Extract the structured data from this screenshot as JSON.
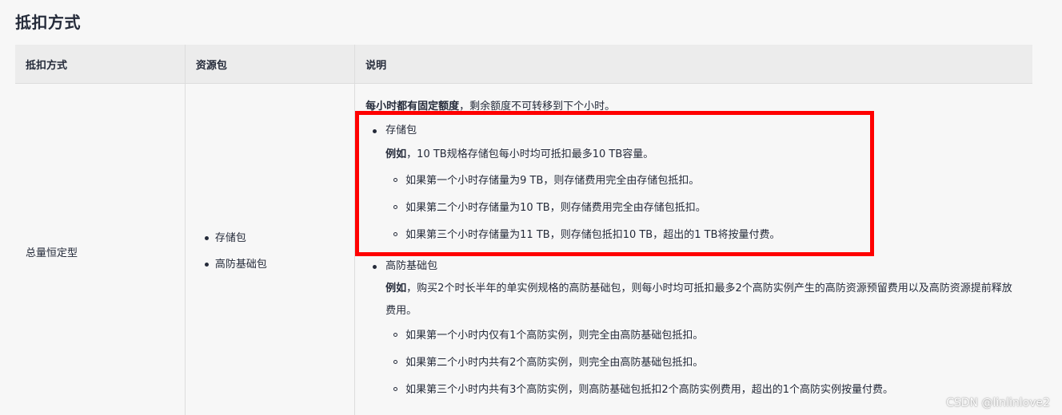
{
  "title": "抵扣方式",
  "table": {
    "headers": [
      "抵扣方式",
      "资源包",
      "说明"
    ],
    "row": {
      "method": "总量恒定型",
      "packages": [
        "存储包",
        "高防基础包"
      ],
      "intro_bold": "每小时都有固定额度",
      "intro_rest": "，剩余额度不可转移到下个小时。",
      "items": [
        {
          "name": "存储包",
          "example_bold": "例如",
          "example_text": "，10 TB规格存储包每小时均可抵扣最多10 TB容量。",
          "cases": [
            "如果第一个小时存储量为9 TB，则存储费用完全由存储包抵扣。",
            "如果第二个小时存储量为10 TB，则存储费用完全由存储包抵扣。",
            "如果第三个小时存储量为11 TB，则存储包抵扣10 TB，超出的1 TB将按量付费。"
          ]
        },
        {
          "name": "高防基础包",
          "example_bold": "例如",
          "example_text": "，购买2个时长半年的单实例规格的高防基础包，则每小时均可抵扣最多2个高防实例产生的高防资源预留费用以及高防资源提前释放费用。",
          "cases": [
            "如果第一个小时内仅有1个高防实例，则完全由高防基础包抵扣。",
            "如果第二个小时内共有2个高防实例，则完全由高防基础包抵扣。",
            "如果第三个小时内共有3个高防实例，则高防基础包抵扣2个高防实例费用，超出的1个高防实例按量付费。"
          ]
        }
      ]
    }
  },
  "highlight_color": "#ff0000",
  "watermark": "CSDN @linlinlove2"
}
